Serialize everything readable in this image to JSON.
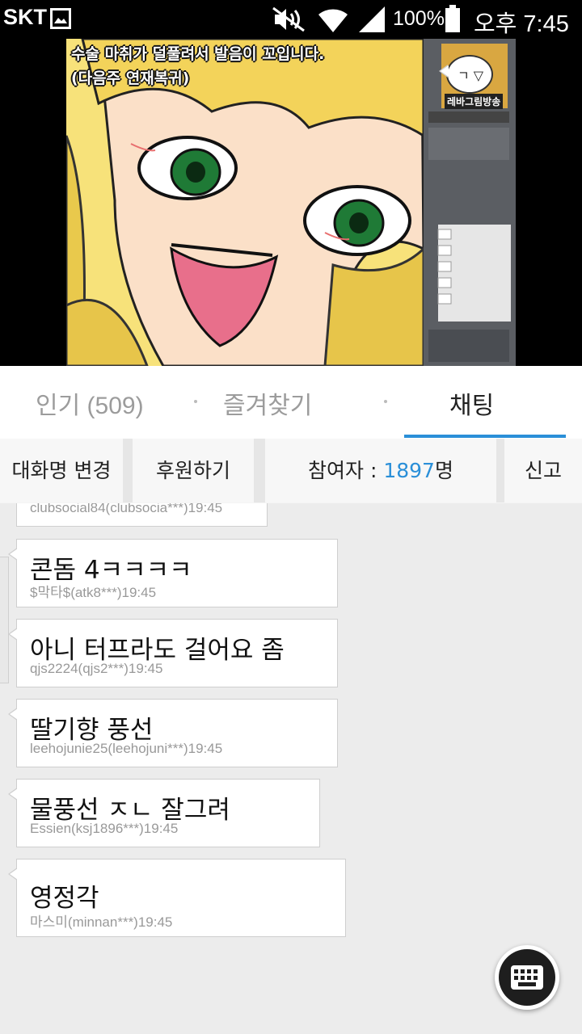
{
  "status_bar": {
    "carrier": "SKT",
    "battery": "100%",
    "time": "오후 7:45",
    "icons": [
      "image-icon",
      "mute-icon",
      "wifi-icon",
      "signal-icon",
      "battery-icon"
    ]
  },
  "video": {
    "caption_line1": "수술 마취가 덜풀려서 발음이 꼬입니다.",
    "caption_line2": "(다음주 연재복귀)",
    "logo_label": "레바그림방송"
  },
  "tabs": [
    {
      "label": "인기 (509)",
      "active": false
    },
    {
      "label": "즐겨찾기",
      "active": false
    },
    {
      "label": "채팅",
      "active": true
    }
  ],
  "action_bar": {
    "rename": "대화명 변경",
    "support": "후원하기",
    "participants_prefix": "참여자 : ",
    "participants_count": "1897",
    "participants_suffix": "명",
    "report": "신고"
  },
  "chat_messages": [
    {
      "text": "",
      "meta": "clubsocial84(clubsocia***)19:45"
    },
    {
      "text": "콘돔 4ㅋㅋㅋㅋ",
      "meta": "$막타$(atk8***)19:45"
    },
    {
      "text": "아니 터프라도 걸어요 좀",
      "meta": "qjs2224(qjs2***)19:45"
    },
    {
      "text": "딸기향 풍선",
      "meta": "leehojunie25(leehojuni***)19:45"
    },
    {
      "text": "물풍선 ㅈㄴ 잘그려",
      "meta": "Essien(ksj1896***)19:45"
    },
    {
      "text": "영정각",
      "meta": "마스미(minnan***)19:45"
    }
  ],
  "colors": {
    "accent": "#2a8fd8",
    "background": "#ececec"
  }
}
